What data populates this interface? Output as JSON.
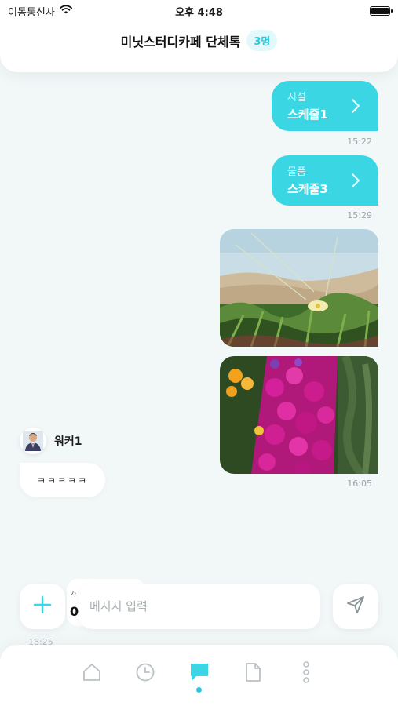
{
  "status_bar": {
    "carrier": "이동통신사",
    "time": "오후 4:48"
  },
  "header": {
    "title": "미닛스터디카페 단체톡",
    "member_count": "3명"
  },
  "messages": {
    "schedules": [
      {
        "category": "시설",
        "name": "스케줄1",
        "time": "15:22"
      },
      {
        "category": "물품",
        "name": "스케줄3",
        "time": "15:29"
      }
    ],
    "photos_time": "16:05",
    "incoming": {
      "sender": "워커1",
      "text": "ㅋㅋㅋㅋㅋ"
    }
  },
  "input": {
    "placeholder": "메시지 입력",
    "partial_card_small": "가",
    "partial_card_big": "0",
    "faded_time": "18:25"
  },
  "tabs": [
    {
      "icon": "home-icon"
    },
    {
      "icon": "clock-icon"
    },
    {
      "icon": "chat-icon",
      "active": true
    },
    {
      "icon": "document-icon"
    },
    {
      "icon": "more-vertical-icon"
    }
  ],
  "colors": {
    "accent": "#3bd6e4",
    "badge_text": "#2bc8dc",
    "background": "#f2f7f8"
  }
}
